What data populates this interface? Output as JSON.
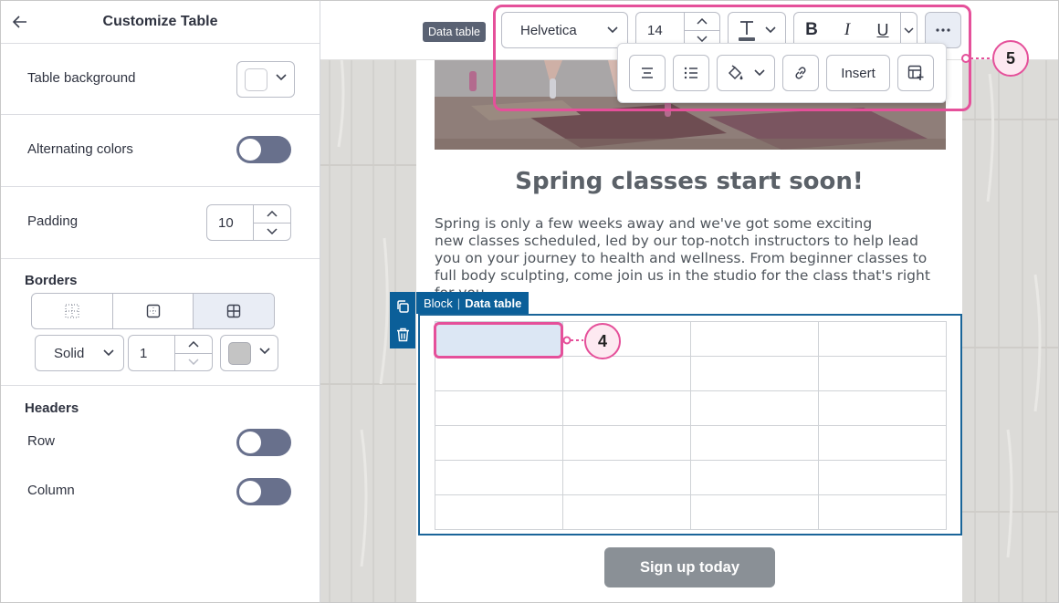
{
  "panel": {
    "title": "Customize Table",
    "table_background_label": "Table background",
    "alternating_colors_label": "Alternating colors",
    "padding_label": "Padding",
    "padding_value": "10",
    "borders_title": "Borders",
    "border_style": "Solid",
    "border_width": "1",
    "headers_title": "Headers",
    "row_label": "Row",
    "column_label": "Column",
    "toggle_color": "#68708c"
  },
  "toolbar": {
    "data_table_tag": "Data table",
    "font_family": "Helvetica",
    "font_size": "14",
    "insert_label": "Insert",
    "callout_number": "5"
  },
  "email": {
    "heading": "Spring classes start soon!",
    "body_lines": [
      "Spring is only a few weeks away and we've got some exciting",
      "new classes scheduled, led by our top-notch instructors to help lead",
      "you on your journey to health and wellness. From beginner classes to",
      "full body sculpting, come join us in the studio for the class that's right",
      "for you"
    ],
    "block_label": "Block",
    "block_type": "Data table",
    "cell_callout_number": "4",
    "cta_label": "Sign up today"
  },
  "colors": {
    "accent_blue": "#0b5f99",
    "callout_pink": "#e5509a",
    "selected_cell": "#dce7f4",
    "button_gray": "#8a9096"
  }
}
